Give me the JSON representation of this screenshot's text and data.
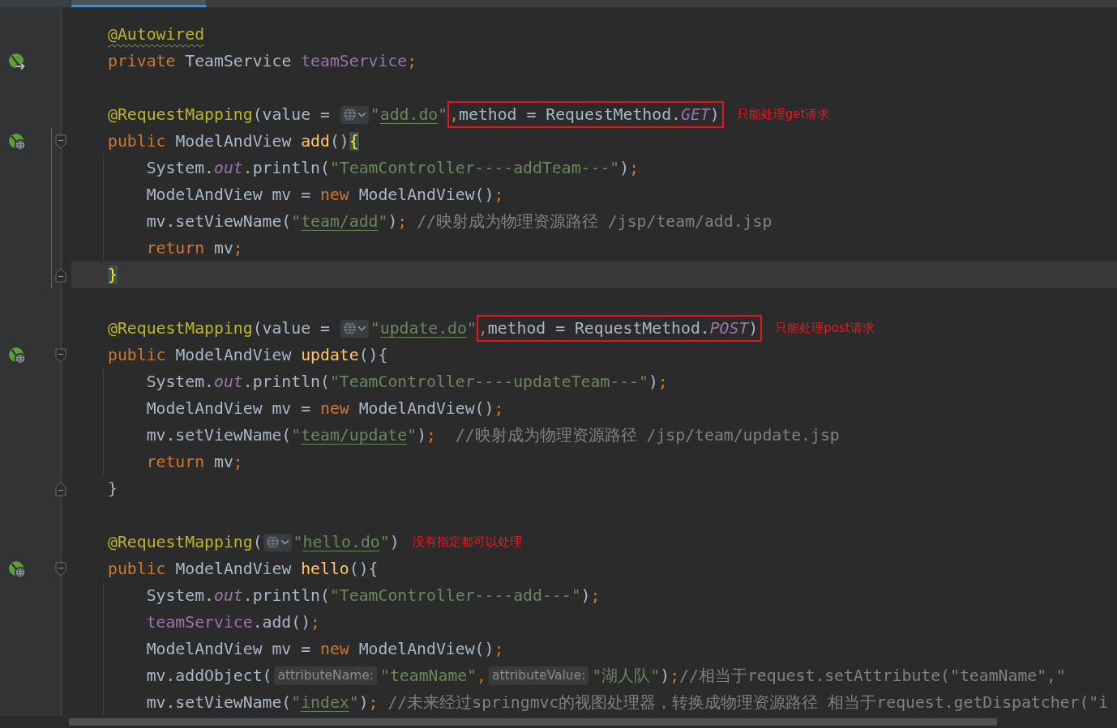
{
  "tab_bar": {
    "tabs": [
      {
        "selected": false
      },
      {
        "selected": true
      }
    ]
  },
  "editor": {
    "lines": [
      {
        "kind": "plain",
        "current": false,
        "tokens": [
          {
            "text": "@Autowired",
            "kind": "annotation-warning"
          }
        ]
      },
      {
        "kind": "injected-field",
        "current": false,
        "tokens": [
          {
            "text": "private",
            "kind": "keyword"
          },
          {
            "text": " TeamService ",
            "kind": "plain"
          },
          {
            "text": "teamService",
            "kind": "field"
          },
          {
            "text": ";",
            "kind": "keyword"
          }
        ]
      },
      {
        "kind": "plain",
        "current": false
      },
      {
        "kind": "plain",
        "current": false,
        "tokens": [
          {
            "text": "@RequestMapping",
            "kind": "annotation"
          },
          {
            "text": "(value = ",
            "kind": "plain"
          },
          {
            "kind": "url-inlay"
          },
          {
            "text": "\"",
            "kind": "string"
          },
          {
            "text": "add.do",
            "kind": "url"
          },
          {
            "text": "\"",
            "kind": "string"
          },
          {
            "kind": "boxed",
            "tokens": [
              {
                "text": ",",
                "kind": "keyword"
              },
              {
                "text": "method = RequestMethod.",
                "kind": "plain"
              },
              {
                "text": "GET",
                "kind": "static"
              },
              {
                "text": ")",
                "kind": "plain"
              }
            ]
          }
        ],
        "note": "只能处理get请求"
      },
      {
        "kind": "endpoint",
        "current": false,
        "tokens": [
          {
            "text": "public",
            "kind": "keyword"
          },
          {
            "text": " ModelAndView ",
            "kind": "plain"
          },
          {
            "text": "add",
            "kind": "method"
          },
          {
            "text": "()",
            "kind": "plain"
          },
          {
            "text": "{",
            "kind": "brace-match"
          }
        ],
        "children": [
          {
            "current": false,
            "tokens": [
              {
                "text": "System.",
                "kind": "plain"
              },
              {
                "text": "out",
                "kind": "static"
              },
              {
                "text": ".println(",
                "kind": "plain"
              },
              {
                "text": "\"TeamController----addTeam---\"",
                "kind": "string"
              },
              {
                "text": ")",
                "kind": "plain"
              },
              {
                "text": ";",
                "kind": "keyword"
              }
            ]
          },
          {
            "current": false,
            "tokens": [
              {
                "text": "ModelAndView mv = ",
                "kind": "plain"
              },
              {
                "text": "new",
                "kind": "keyword"
              },
              {
                "text": " ModelAndView()",
                "kind": "plain"
              },
              {
                "text": ";",
                "kind": "keyword"
              }
            ]
          },
          {
            "current": false,
            "tokens": [
              {
                "text": "mv.setViewName(",
                "kind": "plain"
              },
              {
                "text": "\"",
                "kind": "string"
              },
              {
                "text": "team/add",
                "kind": "url"
              },
              {
                "text": "\"",
                "kind": "string"
              },
              {
                "text": ")",
                "kind": "plain"
              },
              {
                "text": ";",
                "kind": "keyword"
              },
              {
                "text": " //映射成为物理资源路径 /jsp/team/add.jsp",
                "kind": "comment"
              }
            ]
          },
          {
            "current": false,
            "tokens": [
              {
                "text": "return",
                "kind": "keyword"
              },
              {
                "text": " mv",
                "kind": "plain"
              },
              {
                "text": ";",
                "kind": "keyword"
              }
            ]
          }
        ]
      },
      {
        "kind": "plain",
        "current": true,
        "tokens": [
          {
            "text": "}",
            "kind": "brace-match"
          }
        ]
      },
      {
        "kind": "plain",
        "current": false
      },
      {
        "kind": "plain",
        "current": false,
        "tokens": [
          {
            "text": "@RequestMapping",
            "kind": "annotation"
          },
          {
            "text": "(value = ",
            "kind": "plain"
          },
          {
            "kind": "url-inlay"
          },
          {
            "text": "\"",
            "kind": "string"
          },
          {
            "text": "update.do",
            "kind": "url"
          },
          {
            "text": "\"",
            "kind": "string"
          },
          {
            "kind": "boxed",
            "tokens": [
              {
                "text": ",",
                "kind": "keyword"
              },
              {
                "text": "method = RequestMethod.",
                "kind": "plain"
              },
              {
                "text": "POST",
                "kind": "static"
              },
              {
                "text": ")",
                "kind": "plain"
              }
            ]
          }
        ],
        "note": "只能处理post请求"
      },
      {
        "kind": "endpoint",
        "current": false,
        "tokens": [
          {
            "text": "public",
            "kind": "keyword"
          },
          {
            "text": " ModelAndView ",
            "kind": "plain"
          },
          {
            "text": "update",
            "kind": "method"
          },
          {
            "text": "(){",
            "kind": "plain"
          }
        ],
        "children": [
          {
            "current": false,
            "tokens": [
              {
                "text": "System.",
                "kind": "plain"
              },
              {
                "text": "out",
                "kind": "static"
              },
              {
                "text": ".println(",
                "kind": "plain"
              },
              {
                "text": "\"TeamController----updateTeam---\"",
                "kind": "string"
              },
              {
                "text": ")",
                "kind": "plain"
              },
              {
                "text": ";",
                "kind": "keyword"
              }
            ]
          },
          {
            "current": false,
            "tokens": [
              {
                "text": "ModelAndView mv = ",
                "kind": "plain"
              },
              {
                "text": "new",
                "kind": "keyword"
              },
              {
                "text": " ModelAndView()",
                "kind": "plain"
              },
              {
                "text": ";",
                "kind": "keyword"
              }
            ]
          },
          {
            "current": false,
            "tokens": [
              {
                "text": "mv.setViewName(",
                "kind": "plain"
              },
              {
                "text": "\"",
                "kind": "string"
              },
              {
                "text": "team/update",
                "kind": "url"
              },
              {
                "text": "\"",
                "kind": "string"
              },
              {
                "text": ")",
                "kind": "plain"
              },
              {
                "text": ";",
                "kind": "keyword"
              },
              {
                "text": "  //映射成为物理资源路径 /jsp/team/update.jsp",
                "kind": "comment"
              }
            ]
          },
          {
            "current": false,
            "tokens": [
              {
                "text": "return",
                "kind": "keyword"
              },
              {
                "text": " mv",
                "kind": "plain"
              },
              {
                "text": ";",
                "kind": "keyword"
              }
            ]
          }
        ]
      },
      {
        "kind": "plain",
        "current": false,
        "tokens": [
          {
            "text": "}",
            "kind": "plain"
          }
        ]
      },
      {
        "kind": "plain",
        "current": false
      },
      {
        "kind": "plain",
        "current": false,
        "tokens": [
          {
            "text": "@RequestMapping",
            "kind": "annotation"
          },
          {
            "text": "(",
            "kind": "plain"
          },
          {
            "kind": "url-inlay"
          },
          {
            "text": "\"",
            "kind": "string"
          },
          {
            "text": "hello.do",
            "kind": "url"
          },
          {
            "text": "\"",
            "kind": "string"
          },
          {
            "text": ")",
            "kind": "plain"
          }
        ],
        "note": "没有指定都可以处理"
      },
      {
        "kind": "endpoint",
        "current": false,
        "tokens": [
          {
            "text": "public",
            "kind": "keyword"
          },
          {
            "text": " ModelAndView ",
            "kind": "plain"
          },
          {
            "text": "hello",
            "kind": "method"
          },
          {
            "text": "(){",
            "kind": "plain"
          }
        ],
        "children": [
          {
            "current": false,
            "tokens": [
              {
                "text": "System.",
                "kind": "plain"
              },
              {
                "text": "out",
                "kind": "static"
              },
              {
                "text": ".println(",
                "kind": "plain"
              },
              {
                "text": "\"TeamController----add---\"",
                "kind": "string"
              },
              {
                "text": ")",
                "kind": "plain"
              },
              {
                "text": ";",
                "kind": "keyword"
              }
            ]
          },
          {
            "current": false,
            "tokens": [
              {
                "text": "teamService",
                "kind": "field"
              },
              {
                "text": ".add()",
                "kind": "plain"
              },
              {
                "text": ";",
                "kind": "keyword"
              }
            ]
          },
          {
            "current": false,
            "tokens": [
              {
                "text": "ModelAndView mv = ",
                "kind": "plain"
              },
              {
                "text": "new",
                "kind": "keyword"
              },
              {
                "text": " ModelAndView()",
                "kind": "plain"
              },
              {
                "text": ";",
                "kind": "keyword"
              }
            ]
          },
          {
            "current": false,
            "tokens": [
              {
                "text": "mv.addObject(",
                "kind": "plain"
              },
              {
                "text": "attributeName:",
                "kind": "hint"
              },
              {
                "text": "\"teamName\"",
                "kind": "string"
              },
              {
                "text": ",",
                "kind": "keyword"
              },
              {
                "text": "attributeValue:",
                "kind": "hint"
              },
              {
                "text": "\"湖人队\"",
                "kind": "string"
              },
              {
                "text": ")",
                "kind": "plain"
              },
              {
                "text": ";",
                "kind": "keyword"
              },
              {
                "text": "//相当于request.setAttribute(\"teamName\",\"",
                "kind": "comment"
              }
            ]
          },
          {
            "current": false,
            "tokens": [
              {
                "text": "mv.setViewName(",
                "kind": "plain"
              },
              {
                "text": "\"",
                "kind": "string"
              },
              {
                "text": "index",
                "kind": "url"
              },
              {
                "text": "\"",
                "kind": "string"
              },
              {
                "text": ")",
                "kind": "plain"
              },
              {
                "text": ";",
                "kind": "keyword"
              },
              {
                "text": " //未来经过springmvc的视图处理器，转换成物理资源路径 相当于request.getDispatcher(\"i",
                "kind": "comment"
              }
            ]
          }
        ]
      }
    ]
  }
}
